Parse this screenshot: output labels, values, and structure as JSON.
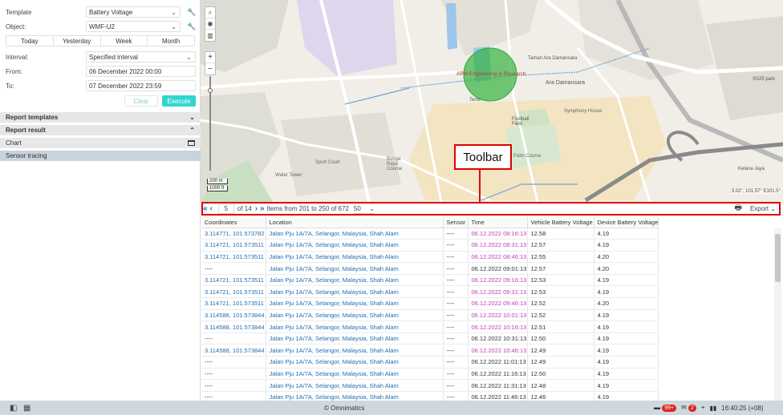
{
  "form": {
    "template_label": "Template",
    "template_value": "Battery Voltage",
    "object_label": "Object:",
    "object_value": "WMF-U2",
    "quick_ranges": [
      "Today",
      "Yesterday",
      "Week",
      "Month"
    ],
    "interval_label": "Interval:",
    "interval_value": "Specified interval",
    "from_label": "From:",
    "from_value": "06 December 2022 00:00",
    "to_label": "To:",
    "to_value": "07 December 2022 23:59",
    "clear_label": "Clear",
    "execute_label": "Execute"
  },
  "sections": {
    "report_templates": "Report templates",
    "report_result": "Report result",
    "chart": "Chart",
    "sensor_tracing": "Sensor tracing"
  },
  "map": {
    "labels": [
      "APM Engineering & Research",
      "Ara Damansara",
      "Tenis",
      "Football Field",
      "Bunga Raya Course",
      "Palm Course",
      "Sport Court",
      "Water Tower",
      "Symphony House",
      "Taman Ara Damansara",
      "SS25 park",
      "Kelana Jaya"
    ],
    "scale_metric": "200 m",
    "scale_imperial": "1000 ft",
    "coords": "3.02°, 101.57°  E101.5°"
  },
  "annotation": {
    "toolbar_label": "Toolbar"
  },
  "pager": {
    "page": "5",
    "of_pages": "of 14",
    "items_text": "Items from 201 to 250 of 672",
    "page_size": "50",
    "export_label": "Export"
  },
  "table": {
    "headers": [
      "Coordinates",
      "Location",
      "Sensor",
      "Time",
      "Vehicle Battery Voltage",
      "Device Battery Voltage"
    ],
    "rows": [
      {
        "coord": "3.114771, 101.573782",
        "loc": "Jalan Pju 1A/7A, Selangor, Malaysia, Shah Alam",
        "sensor": "----",
        "time": "06.12.2022 08:16:13",
        "vbv": "12.58",
        "dbv": "4.19",
        "hl": true
      },
      {
        "coord": "3.114721, 101.573511",
        "loc": "Jalan Pju 1A/7A, Selangor, Malaysia, Shah Alam",
        "sensor": "----",
        "time": "06.12.2022 08:31:13",
        "vbv": "12.57",
        "dbv": "4.19",
        "hl": true
      },
      {
        "coord": "3.114721, 101.573511",
        "loc": "Jalan Pju 1A/7A, Selangor, Malaysia, Shah Alam",
        "sensor": "----",
        "time": "06.12.2022 08:46:13",
        "vbv": "12.55",
        "dbv": "4.20",
        "hl": true
      },
      {
        "coord": "----",
        "loc": "Jalan Pju 1A/7A, Selangor, Malaysia, Shah Alam",
        "sensor": "----",
        "time": "06.12.2022 09:01:13",
        "vbv": "12.57",
        "dbv": "4.20",
        "hl": false
      },
      {
        "coord": "3.114721, 101.573511",
        "loc": "Jalan Pju 1A/7A, Selangor, Malaysia, Shah Alam",
        "sensor": "----",
        "time": "06.12.2022 09:16:13",
        "vbv": "12.53",
        "dbv": "4.19",
        "hl": true
      },
      {
        "coord": "3.114721, 101.573511",
        "loc": "Jalan Pju 1A/7A, Selangor, Malaysia, Shah Alam",
        "sensor": "----",
        "time": "06.12.2022 09:31:13",
        "vbv": "12.53",
        "dbv": "4.19",
        "hl": true
      },
      {
        "coord": "3.114721, 101.573511",
        "loc": "Jalan Pju 1A/7A, Selangor, Malaysia, Shah Alam",
        "sensor": "----",
        "time": "06.12.2022 09:46:13",
        "vbv": "12.52",
        "dbv": "4.20",
        "hl": true
      },
      {
        "coord": "3.114588, 101.573844",
        "loc": "Jalan Pju 1A/7A, Selangor, Malaysia, Shah Alam",
        "sensor": "----",
        "time": "06.12.2022 10:01:13",
        "vbv": "12.52",
        "dbv": "4.19",
        "hl": true
      },
      {
        "coord": "3.114588, 101.573844",
        "loc": "Jalan Pju 1A/7A, Selangor, Malaysia, Shah Alam",
        "sensor": "----",
        "time": "06.12.2022 10:16:13",
        "vbv": "12.51",
        "dbv": "4.19",
        "hl": true
      },
      {
        "coord": "----",
        "loc": "Jalan Pju 1A/7A, Selangor, Malaysia, Shah Alam",
        "sensor": "----",
        "time": "06.12.2022 10:31:13",
        "vbv": "12.50",
        "dbv": "4.19",
        "hl": false
      },
      {
        "coord": "3.114588, 101.573844",
        "loc": "Jalan Pju 1A/7A, Selangor, Malaysia, Shah Alam",
        "sensor": "----",
        "time": "06.12.2022 10:46:13",
        "vbv": "12.49",
        "dbv": "4.19",
        "hl": true
      },
      {
        "coord": "----",
        "loc": "Jalan Pju 1A/7A, Selangor, Malaysia, Shah Alam",
        "sensor": "----",
        "time": "06.12.2022 11:01:13",
        "vbv": "12.49",
        "dbv": "4.19",
        "hl": false
      },
      {
        "coord": "----",
        "loc": "Jalan Pju 1A/7A, Selangor, Malaysia, Shah Alam",
        "sensor": "----",
        "time": "06.12.2022 11:16:13",
        "vbv": "12.50",
        "dbv": "4.19",
        "hl": false
      },
      {
        "coord": "----",
        "loc": "Jalan Pju 1A/7A, Selangor, Malaysia, Shah Alam",
        "sensor": "----",
        "time": "06.12.2022 11:31:13",
        "vbv": "12.48",
        "dbv": "4.19",
        "hl": false
      },
      {
        "coord": "----",
        "loc": "Jalan Pju 1A/7A, Selangor, Malaysia, Shah Alam",
        "sensor": "----",
        "time": "06.12.2022 11:46:13",
        "vbv": "12.46",
        "dbv": "4.19",
        "hl": false
      }
    ]
  },
  "footer": {
    "copyright": "© Omnimatics",
    "notif_count": "99+",
    "msg_count": "2",
    "clock": "16:40:25 (+08)"
  },
  "colors": {
    "accent": "#31d6d0",
    "link": "#1f6db3",
    "highlight_time": "#c03fb5",
    "annotation": "#e00000"
  }
}
